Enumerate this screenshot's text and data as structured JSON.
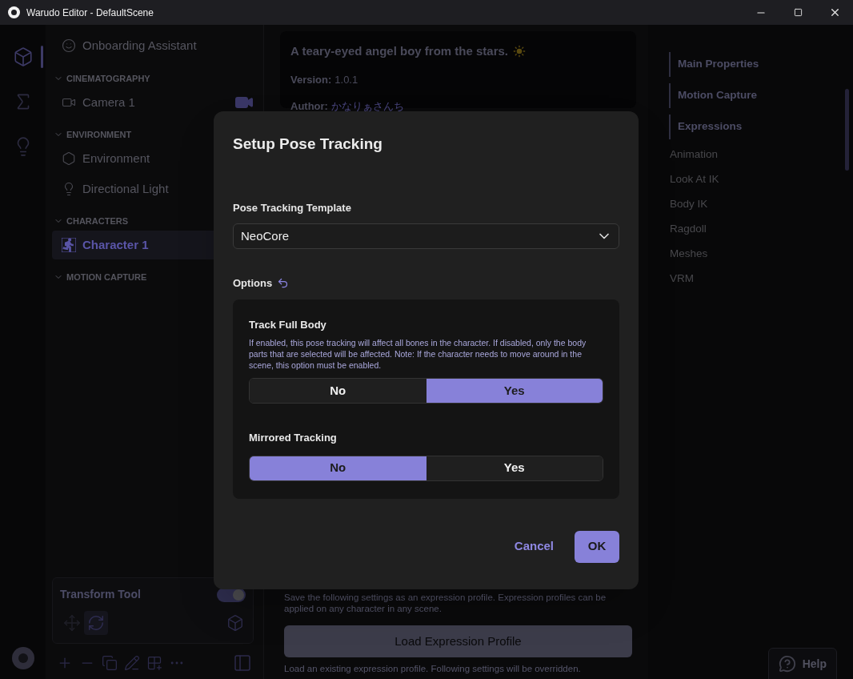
{
  "window": {
    "title": "Warudo Editor - DefaultScene"
  },
  "rail": [
    {
      "kind": "cube",
      "selected": true
    },
    {
      "kind": "sigma",
      "selected": false
    },
    {
      "kind": "bulb",
      "selected": false
    }
  ],
  "sidebar": {
    "assistant": "Onboarding Assistant",
    "sections": [
      {
        "title": "CINEMATOGRAPHY",
        "expanded": true,
        "items": [
          {
            "label": "Camera 1",
            "kind": "camera",
            "selected": false,
            "active_camera": true
          }
        ]
      },
      {
        "title": "ENVIRONMENT",
        "expanded": true,
        "items": [
          {
            "label": "Environment",
            "kind": "environment",
            "selected": false
          },
          {
            "label": "Directional Light",
            "kind": "light",
            "selected": false
          }
        ]
      },
      {
        "title": "CHARACTERS",
        "expanded": true,
        "items": [
          {
            "label": "Character 1",
            "kind": "character",
            "selected": true
          }
        ]
      },
      {
        "title": "MOTION CAPTURE",
        "expanded": true
      }
    ]
  },
  "transform_tool": {
    "title": "Transform Tool",
    "on": true,
    "modes": [
      {
        "kind": "move",
        "selected": false
      },
      {
        "kind": "rotate",
        "selected": true
      }
    ]
  },
  "main": {
    "description": "A teary-eyed angel boy from the stars.",
    "version_label": "Version:",
    "version": "1.0.1",
    "author_label": "Author:",
    "author": "かなりぁさんち",
    "save_description": "Save the following settings as an expression profile. Expression profiles can be applied on any character in any scene.",
    "load_button": "Load Expression Profile",
    "load_description": "Load an existing expression profile. Following settings will be overridden."
  },
  "outline": [
    {
      "label": "Main Properties",
      "active": true
    },
    {
      "label": "Motion Capture",
      "active": true
    },
    {
      "label": "Expressions",
      "active": true
    },
    {
      "label": "Animation",
      "active": false
    },
    {
      "label": "Look At IK",
      "active": false
    },
    {
      "label": "Body IK",
      "active": false
    },
    {
      "label": "Ragdoll",
      "active": false
    },
    {
      "label": "Meshes",
      "active": false
    },
    {
      "label": "VRM",
      "active": false
    }
  ],
  "help": "Help",
  "dialog": {
    "title": "Setup Pose Tracking",
    "template_label": "Pose Tracking Template",
    "template": "NeoCore",
    "options_label": "Options",
    "options": [
      {
        "title": "Track Full Body",
        "description": "If enabled, this pose tracking will affect all bones in the character. If disabled, only the body parts that are selected will be affected. Note: If the character needs to move around in the scene, this option must be enabled.",
        "choices": [
          {
            "label": "No",
            "selected": false
          },
          {
            "label": "Yes",
            "selected": true
          }
        ]
      },
      {
        "title": "Mirrored Tracking",
        "choices": [
          {
            "label": "No",
            "selected": true
          },
          {
            "label": "Yes",
            "selected": false
          }
        ]
      }
    ],
    "cancel": "Cancel",
    "ok": "OK"
  }
}
